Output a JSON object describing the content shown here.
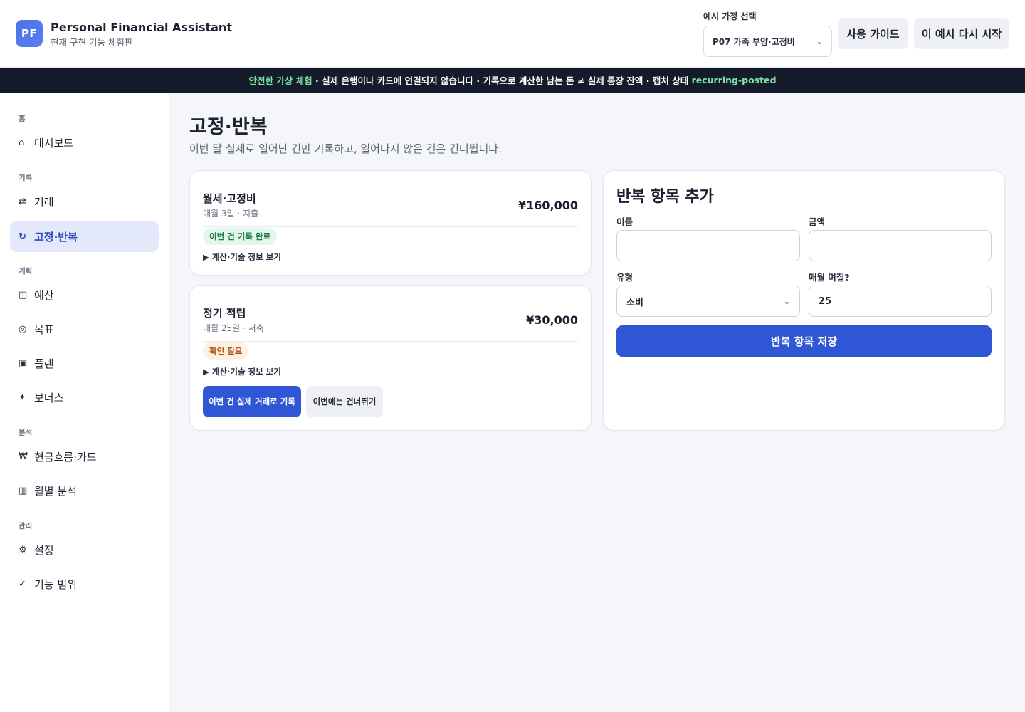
{
  "header": {
    "logo_text": "PF",
    "title": "Personal Financial Assistant",
    "subtitle": "현재 구현 기능 체험판",
    "scenario_label": "예시 가정 선택",
    "scenario_selected": "P07 가족 부양·고정비",
    "guide_button": "사용 가이드",
    "restart_button": "이 예시 다시 시작"
  },
  "banner": {
    "highlight": "안전한 가상 체험",
    "text": " · 실제 은행이나 카드에 연결되지 않습니다 · 기록으로 계산한 남는 돈 ≠ 실제 통장 잔액 · 캡처 상태 ",
    "state_code": "recurring-posted"
  },
  "sidebar": {
    "sections": [
      "홈",
      "기록",
      "계획",
      "분석",
      "관리"
    ],
    "items": [
      {
        "label": "대시보드",
        "icon": "⌂"
      },
      {
        "label": "거래",
        "icon": "⇄"
      },
      {
        "label": "고정·반복",
        "icon": "↻"
      },
      {
        "label": "예산",
        "icon": "◫"
      },
      {
        "label": "목표",
        "icon": "◎"
      },
      {
        "label": "플랜",
        "icon": "▣"
      },
      {
        "label": "보너스",
        "icon": "✦"
      },
      {
        "label": "현금흐름·카드",
        "icon": "₩"
      },
      {
        "label": "월별 분석",
        "icon": "▥"
      },
      {
        "label": "설정",
        "icon": "⚙"
      },
      {
        "label": "기능 범위",
        "icon": "✓"
      }
    ]
  },
  "main": {
    "title": "고정·반복",
    "subtitle": "이번 달 실제로 일어난 건만 기록하고, 일어나지 않은 건은 건너뜁니다.",
    "recurring_items": [
      {
        "name": "월세·고정비",
        "meta": "매월 3일 · 지출",
        "amount": "¥160,000",
        "status": "이번 건 기록 완료",
        "details_label": "▶ 계산·기술 정보 보기"
      },
      {
        "name": "정기 적립",
        "meta": "매월 25일 · 저축",
        "amount": "¥30,000",
        "status": "확인 필요",
        "details_label": "▶ 계산·기술 정보 보기",
        "record_button": "이번 건 실제 거래로 기록",
        "skip_button": "이번에는 건너뛰기"
      }
    ],
    "form": {
      "title": "반복 항목 추가",
      "name_label": "이름",
      "name_value": "",
      "amount_label": "금액",
      "amount_value": "",
      "type_label": "유형",
      "type_value": "소비",
      "day_label": "매월 며칠?",
      "day_value": "25",
      "save_button": "반복 항목 저장"
    }
  }
}
